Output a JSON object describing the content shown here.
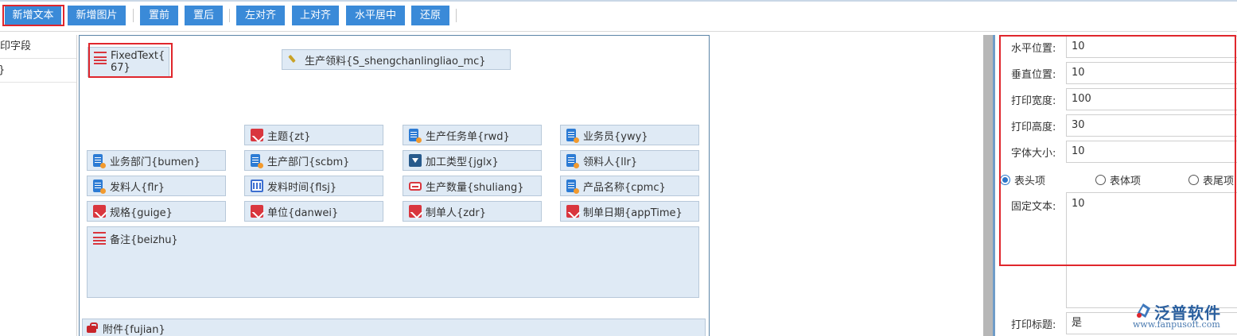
{
  "toolbar": {
    "buttons": [
      {
        "label": "新增文本"
      },
      {
        "label": "新增图片"
      },
      {
        "label": "置前"
      },
      {
        "label": "置后"
      },
      {
        "label": "左对齐"
      },
      {
        "label": "上对齐"
      },
      {
        "label": "水平居中"
      },
      {
        "label": "还原"
      }
    ]
  },
  "left_list": {
    "items": [
      {
        "label": "打印字段"
      },
      {
        "label": "}"
      }
    ]
  },
  "canvas": {
    "fixed_text": {
      "line1": "FixedText{",
      "line2": "67}"
    },
    "fields": [
      {
        "label": "生产领料{S_shengchanlingliao_mc}",
        "icon": "pen-icon"
      },
      {
        "label": "主题{zt}",
        "icon": "edit-icon"
      },
      {
        "label": "生产任务单{rwd}",
        "icon": "list-icon"
      },
      {
        "label": "业务员{ywy}",
        "icon": "list-icon"
      },
      {
        "label": "业务部门{bumen}",
        "icon": "list-icon"
      },
      {
        "label": "生产部门{scbm}",
        "icon": "list-icon"
      },
      {
        "label": "加工类型{jglx}",
        "icon": "dropdown-icon"
      },
      {
        "label": "领料人{llr}",
        "icon": "list-icon"
      },
      {
        "label": "发料人{flr}",
        "icon": "list-icon"
      },
      {
        "label": "发料时间{flsj}",
        "icon": "calendar-icon"
      },
      {
        "label": "生产数量{shuliang}",
        "icon": "number-icon"
      },
      {
        "label": "产品名称{cpmc}",
        "icon": "list-icon"
      },
      {
        "label": "规格{guige}",
        "icon": "edit-icon"
      },
      {
        "label": "单位{danwei}",
        "icon": "edit-icon"
      },
      {
        "label": "制单人{zdr}",
        "icon": "edit-icon"
      },
      {
        "label": "制单日期{appTime}",
        "icon": "edit-icon"
      },
      {
        "label": "备注{beizhu}",
        "icon": "text-icon"
      },
      {
        "label": "附件{fujian}",
        "icon": "attachment-icon"
      }
    ]
  },
  "properties": {
    "horizontal_position": {
      "label": "水平位置:",
      "value": "10"
    },
    "vertical_position": {
      "label": "垂直位置:",
      "value": "10"
    },
    "print_width": {
      "label": "打印宽度:",
      "value": "100"
    },
    "print_height": {
      "label": "打印高度:",
      "value": "30"
    },
    "font_size": {
      "label": "字体大小:",
      "value": "10"
    },
    "section_options": [
      {
        "label": "表头项",
        "selected": true
      },
      {
        "label": "表体项",
        "selected": false
      },
      {
        "label": "表尾项",
        "selected": false
      }
    ],
    "fixed_text": {
      "label": "固定文本:",
      "value": "10"
    },
    "print_title": {
      "label": "打印标题:",
      "value": "是"
    }
  },
  "logo": {
    "brand": "泛普软件",
    "site": "www.fanpusoft.com"
  },
  "colors": {
    "accent": "#3a8ad8",
    "highlight": "#e0262c",
    "field_bg": "#dfeaf5"
  }
}
